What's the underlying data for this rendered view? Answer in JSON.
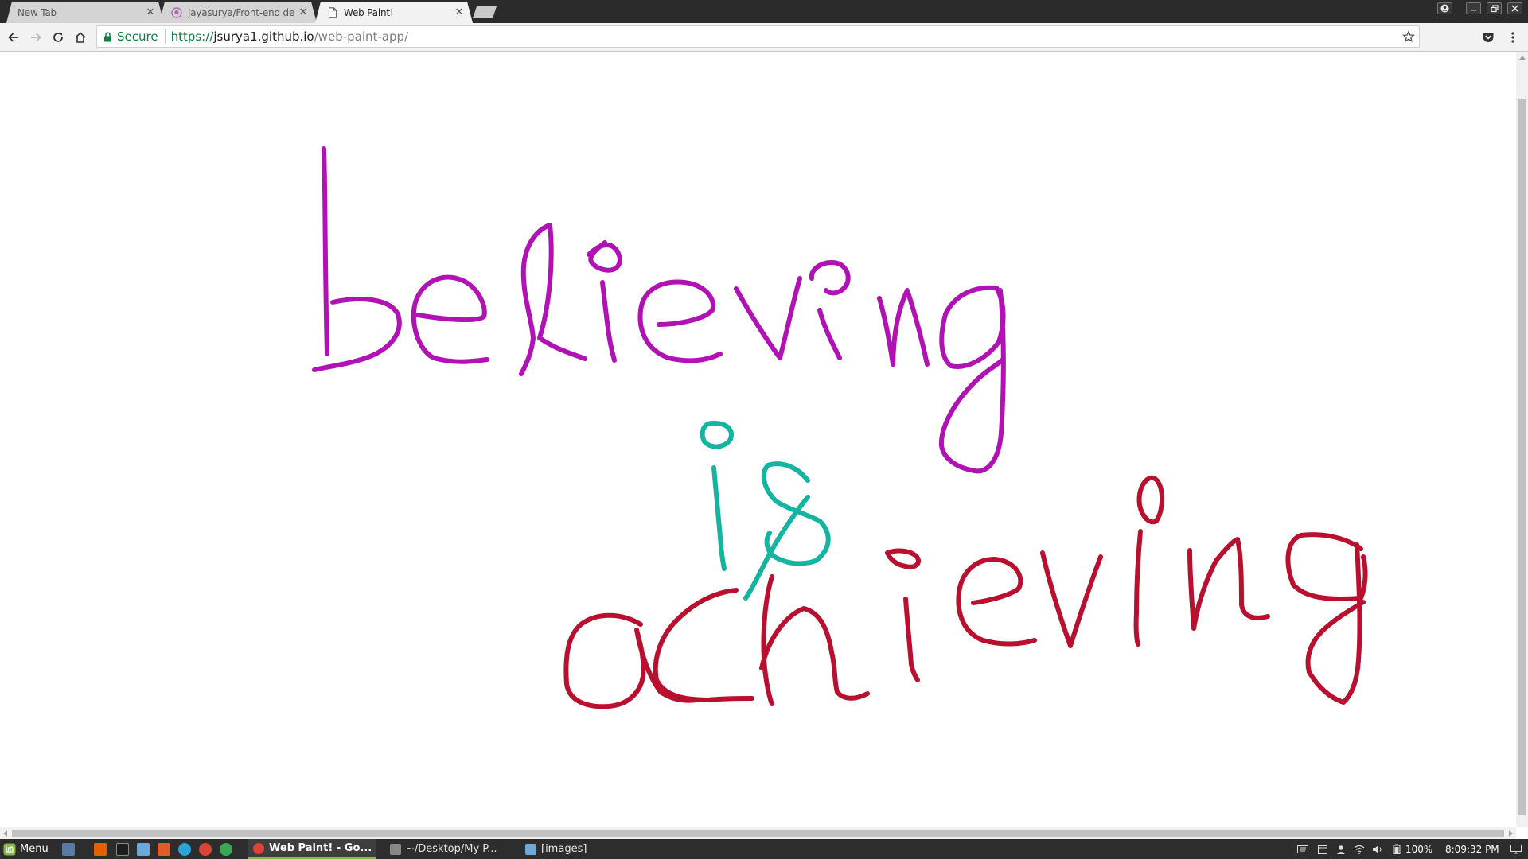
{
  "browser": {
    "tabs": [
      {
        "title": "New Tab",
        "active": false,
        "favicon": "none"
      },
      {
        "title": "jayasurya/Front-end de",
        "active": false,
        "favicon": "github-octocat-icon"
      },
      {
        "title": "Web Paint!",
        "active": true,
        "favicon": "page-icon"
      }
    ],
    "address_bar": {
      "secure_label": "Secure",
      "url_scheme": "https://",
      "url_host": "jsurya1.github.io",
      "url_path": "/web-paint-app/"
    }
  },
  "canvas": {
    "background": "#ffffff",
    "words": [
      {
        "text": "believing",
        "color": "#b012b4"
      },
      {
        "text": "is",
        "color": "#14b4a0"
      },
      {
        "text": "achieving",
        "color": "#b8102e"
      }
    ]
  },
  "taskbar": {
    "menu_label": "Menu",
    "windows": [
      {
        "title": "Web Paint! - Go...",
        "active": true
      },
      {
        "title": "~/Desktop/My P...",
        "active": false
      },
      {
        "title": "[images]",
        "active": false
      }
    ],
    "battery": "100%",
    "clock": "8:09:32 PM"
  }
}
